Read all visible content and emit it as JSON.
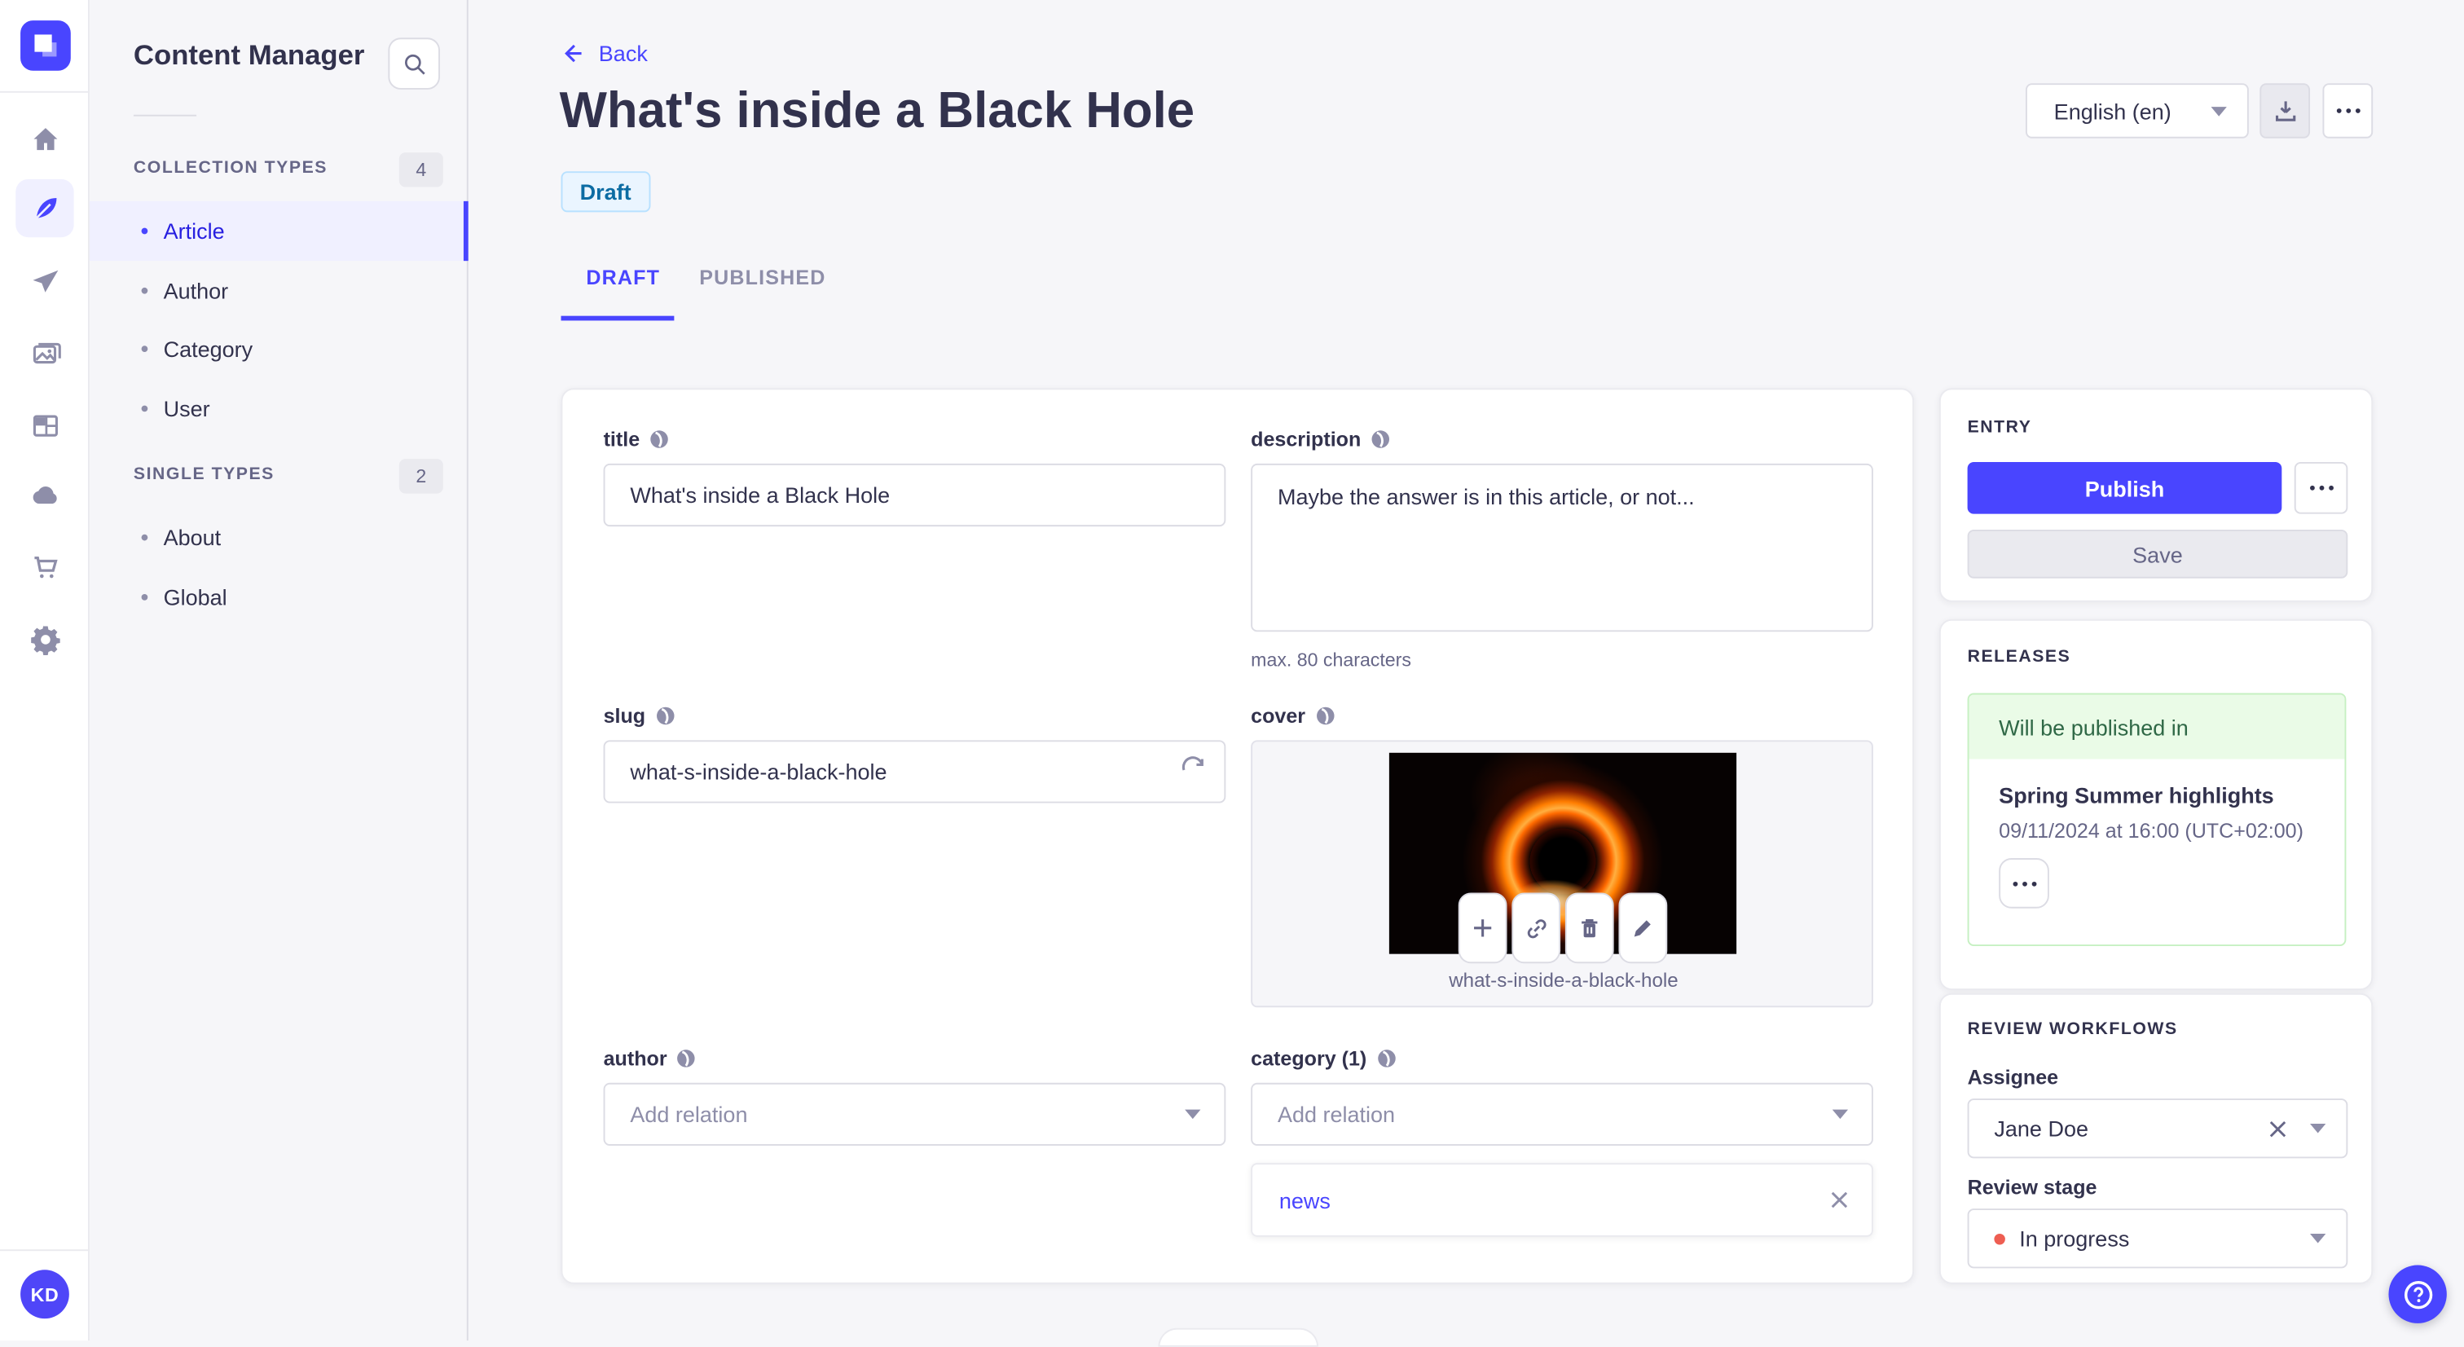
{
  "colors": {
    "accent": "#4945ff",
    "accent_text": "#271fe0",
    "text": "#32324d",
    "muted": "#666687",
    "subtle": "#8e8ea9",
    "border": "#dcdce4",
    "background": "#f6f6f9",
    "draft_bg": "#eaf5ff",
    "draft_border": "#b8e1ff",
    "draft_text": "#0c6ca3",
    "success_bg": "#eafbe7",
    "success_border": "#c6f0c2",
    "success_text": "#2f6846",
    "danger_dot": "#ee5e52"
  },
  "icons": {
    "rail": [
      "home-icon",
      "feather-icon",
      "paper-plane-icon",
      "images-icon",
      "layout-icon",
      "cloud-icon",
      "cart-icon",
      "gear-icon"
    ],
    "field_label": "globe-icon",
    "cover_toolbar": [
      "plus-icon",
      "link-icon",
      "trash-icon",
      "pencil-icon"
    ],
    "misc": [
      "search-icon",
      "back-arrow-icon",
      "download-icon",
      "ellipsis-icon",
      "refresh-icon",
      "chevron-down-icon",
      "clear-x-icon",
      "help-question-icon"
    ]
  },
  "nav_rail": {
    "avatar_initials": "KD"
  },
  "sidebar": {
    "title": "Content Manager",
    "sections": [
      {
        "label": "COLLECTION TYPES",
        "count": "4",
        "items": [
          {
            "label": "Article"
          },
          {
            "label": "Author"
          },
          {
            "label": "Category"
          },
          {
            "label": "User"
          }
        ]
      },
      {
        "label": "SINGLE TYPES",
        "count": "2",
        "items": [
          {
            "label": "About"
          },
          {
            "label": "Global"
          }
        ]
      }
    ]
  },
  "header": {
    "back_label": "Back",
    "title": "What's inside a Black Hole",
    "status_badge": "Draft",
    "locale_selected": "English (en)"
  },
  "tabs": {
    "draft": "DRAFT",
    "published": "PUBLISHED"
  },
  "form": {
    "title": {
      "label": "title",
      "value": "What's inside a Black Hole"
    },
    "description": {
      "label": "description",
      "value": "Maybe the answer is in this article, or not...",
      "hint": "max. 80 characters"
    },
    "slug": {
      "label": "slug",
      "value": "what-s-inside-a-black-hole"
    },
    "cover": {
      "label": "cover",
      "filename": "what-s-inside-a-black-hole"
    },
    "author": {
      "label": "author",
      "placeholder": "Add relation"
    },
    "category": {
      "label": "category (1)",
      "placeholder": "Add relation",
      "relations": [
        {
          "label": "news"
        }
      ]
    }
  },
  "entry_panel": {
    "title": "ENTRY",
    "publish_label": "Publish",
    "save_label": "Save"
  },
  "releases_panel": {
    "title": "RELEASES",
    "status": "Will be published in",
    "release_name": "Spring Summer highlights",
    "release_date": "09/11/2024 at 16:00 (UTC+02:00)"
  },
  "review_panel": {
    "title": "REVIEW WORKFLOWS",
    "assignee_label": "Assignee",
    "assignee_value": "Jane Doe",
    "stage_label": "Review stage",
    "stage_value": "In progress"
  }
}
